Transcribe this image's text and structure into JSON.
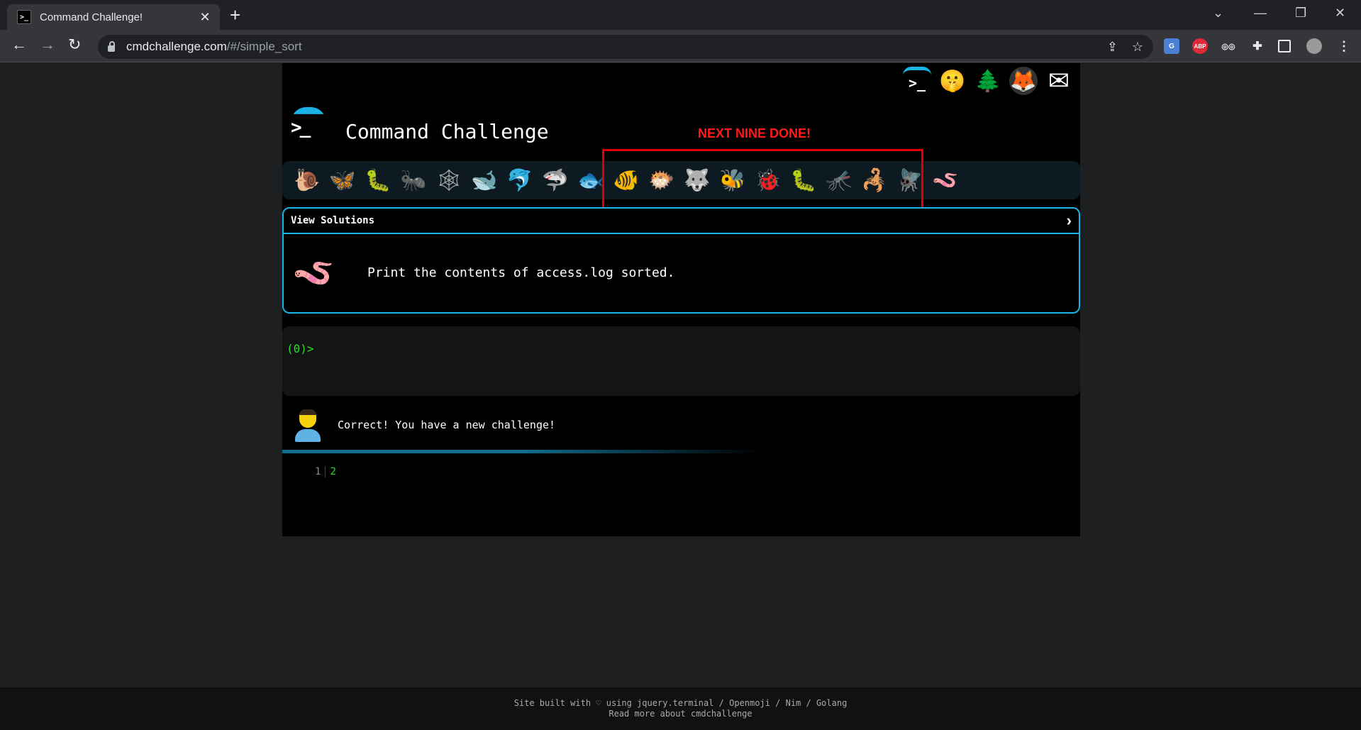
{
  "browser": {
    "tab_title": "Command Challenge!",
    "tab_favicon": ">_",
    "tab_close": "✕",
    "new_tab": "+",
    "url_host": "cmdchallenge.com",
    "url_path": "/#/simple_sort",
    "window_controls": [
      "⌄",
      "—",
      "❐",
      "✕"
    ],
    "nav": {
      "back": "←",
      "forward": "→",
      "reload": "↻"
    },
    "extensions": [
      {
        "name": "translate-icon",
        "label": "G",
        "color": "#4a7fd4"
      },
      {
        "name": "adblock-icon",
        "label": "ABP",
        "color": "#e02a39"
      },
      {
        "name": "reader-icon",
        "label": "◎◎",
        "color": "#35363a"
      },
      {
        "name": "puzzle-icon",
        "label": "✚",
        "color": "#35363a"
      }
    ]
  },
  "site": {
    "title": "Command Challenge",
    "logo_text": ">_",
    "top_icons": [
      {
        "name": "terminal-icon",
        "glyph": ">_"
      },
      {
        "name": "shushing-face-icon",
        "glyph": "🤫"
      },
      {
        "name": "tree-icon",
        "glyph": "🌲"
      },
      {
        "name": "gitlab-icon",
        "glyph": "🦊"
      },
      {
        "name": "mail-icon",
        "glyph": "✉"
      }
    ],
    "annotation_label": "NEXT NINE DONE!",
    "badges": [
      {
        "name": "snail-badge-icon",
        "glyph": "🐌"
      },
      {
        "name": "butterfly-badge-icon",
        "glyph": "🦋"
      },
      {
        "name": "caterpillar-badge-icon",
        "glyph": "🐛"
      },
      {
        "name": "ant-badge-icon",
        "glyph": "🐜"
      },
      {
        "name": "spider-web-badge-icon",
        "glyph": "🕸"
      },
      {
        "name": "whale-badge-icon",
        "glyph": "🐋"
      },
      {
        "name": "dolphin-badge-icon",
        "glyph": "🐬"
      },
      {
        "name": "shark-badge-icon",
        "glyph": "🦈"
      },
      {
        "name": "fish-badge-icon",
        "glyph": "🐟"
      },
      {
        "name": "tropical-fish-badge-icon",
        "glyph": "🐠"
      },
      {
        "name": "blowfish-badge-icon",
        "glyph": "🐡"
      },
      {
        "name": "wolf-badge-icon",
        "glyph": "🐺"
      },
      {
        "name": "bee-badge-icon",
        "glyph": "🐝"
      },
      {
        "name": "ladybug-badge-icon",
        "glyph": "🐞"
      },
      {
        "name": "worm-green-badge-icon",
        "glyph": "🐛"
      },
      {
        "name": "mosquito-badge-icon",
        "glyph": "🦟"
      },
      {
        "name": "scorpion-badge-icon",
        "glyph": "🦂"
      },
      {
        "name": "fly-badge-icon",
        "glyph": "🪰"
      },
      {
        "name": "worm-badge-icon",
        "glyph": "🪱"
      }
    ],
    "solutions_title": "View Solutions",
    "solutions_chevron": "›",
    "challenge_icon": "🪱",
    "task": "Print the contents of access.log sorted.",
    "prompt": "(0)>",
    "status": "Correct! You have a new challenge!",
    "line_numbers": [
      "1",
      "2"
    ]
  },
  "footer": {
    "line1": "Site built with ♡ using jquery.terminal / Openmoji / Nim / Golang",
    "line2": "Read more about cmdchallenge"
  }
}
